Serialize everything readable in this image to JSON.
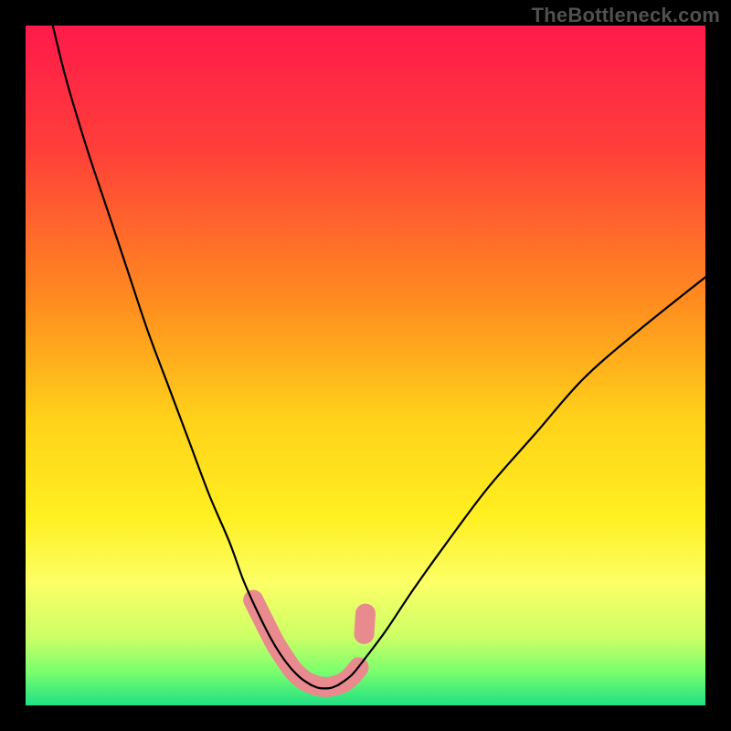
{
  "watermark": "TheBottleneck.com",
  "chart_data": {
    "type": "line",
    "title": "",
    "xlabel": "",
    "ylabel": "",
    "xlim": [
      0,
      100
    ],
    "ylim": [
      0,
      100
    ],
    "grid": false,
    "legend": false,
    "background_gradient": {
      "stops": [
        {
          "offset": 0.0,
          "color": "#ff1a4a"
        },
        {
          "offset": 0.18,
          "color": "#ff3e3a"
        },
        {
          "offset": 0.4,
          "color": "#ff8a1f"
        },
        {
          "offset": 0.58,
          "color": "#ffd21a"
        },
        {
          "offset": 0.72,
          "color": "#ffef20"
        },
        {
          "offset": 0.82,
          "color": "#fcff66"
        },
        {
          "offset": 0.9,
          "color": "#ccff66"
        },
        {
          "offset": 0.95,
          "color": "#7bff6e"
        },
        {
          "offset": 1.0,
          "color": "#20e083"
        }
      ]
    },
    "series": [
      {
        "name": "left-curve",
        "color": "#000000",
        "width": 2.2,
        "x": [
          4,
          6,
          9,
          12,
          15,
          18,
          21,
          24,
          27,
          30,
          32,
          34,
          36,
          37.5,
          39,
          40.5,
          42
        ],
        "y": [
          100,
          92,
          82,
          73,
          64,
          55,
          47,
          39,
          31,
          24,
          18.5,
          14,
          10,
          7.5,
          5.5,
          4,
          3
        ]
      },
      {
        "name": "right-curve",
        "color": "#000000",
        "width": 2.2,
        "x": [
          46,
          48,
          50,
          53,
          57,
          62,
          68,
          75,
          82,
          90,
          100
        ],
        "y": [
          3,
          4.5,
          7,
          11,
          17,
          24,
          32,
          40,
          48,
          55,
          63
        ]
      },
      {
        "name": "valley-floor",
        "color": "#000000",
        "width": 2.2,
        "x": [
          42,
          43,
          44,
          45,
          46
        ],
        "y": [
          3,
          2.6,
          2.5,
          2.6,
          3
        ]
      }
    ],
    "markers": [
      {
        "name": "highlight-dots",
        "color": "#e98a8e",
        "shape": "round",
        "points": [
          {
            "x": 33.5,
            "y": 15.5
          },
          {
            "x": 35.5,
            "y": 11.5
          },
          {
            "x": 36.8,
            "y": 9.0
          },
          {
            "x": 38.2,
            "y": 6.8
          },
          {
            "x": 39.5,
            "y": 5.0
          },
          {
            "x": 41.0,
            "y": 3.7
          },
          {
            "x": 42.5,
            "y": 3.0
          },
          {
            "x": 44.0,
            "y": 2.7
          },
          {
            "x": 45.5,
            "y": 2.9
          },
          {
            "x": 46.8,
            "y": 3.4
          },
          {
            "x": 48.0,
            "y": 4.4
          },
          {
            "x": 49.0,
            "y": 5.6
          },
          {
            "x": 49.8,
            "y": 10.5
          },
          {
            "x": 50.0,
            "y": 13.5
          }
        ]
      }
    ]
  }
}
